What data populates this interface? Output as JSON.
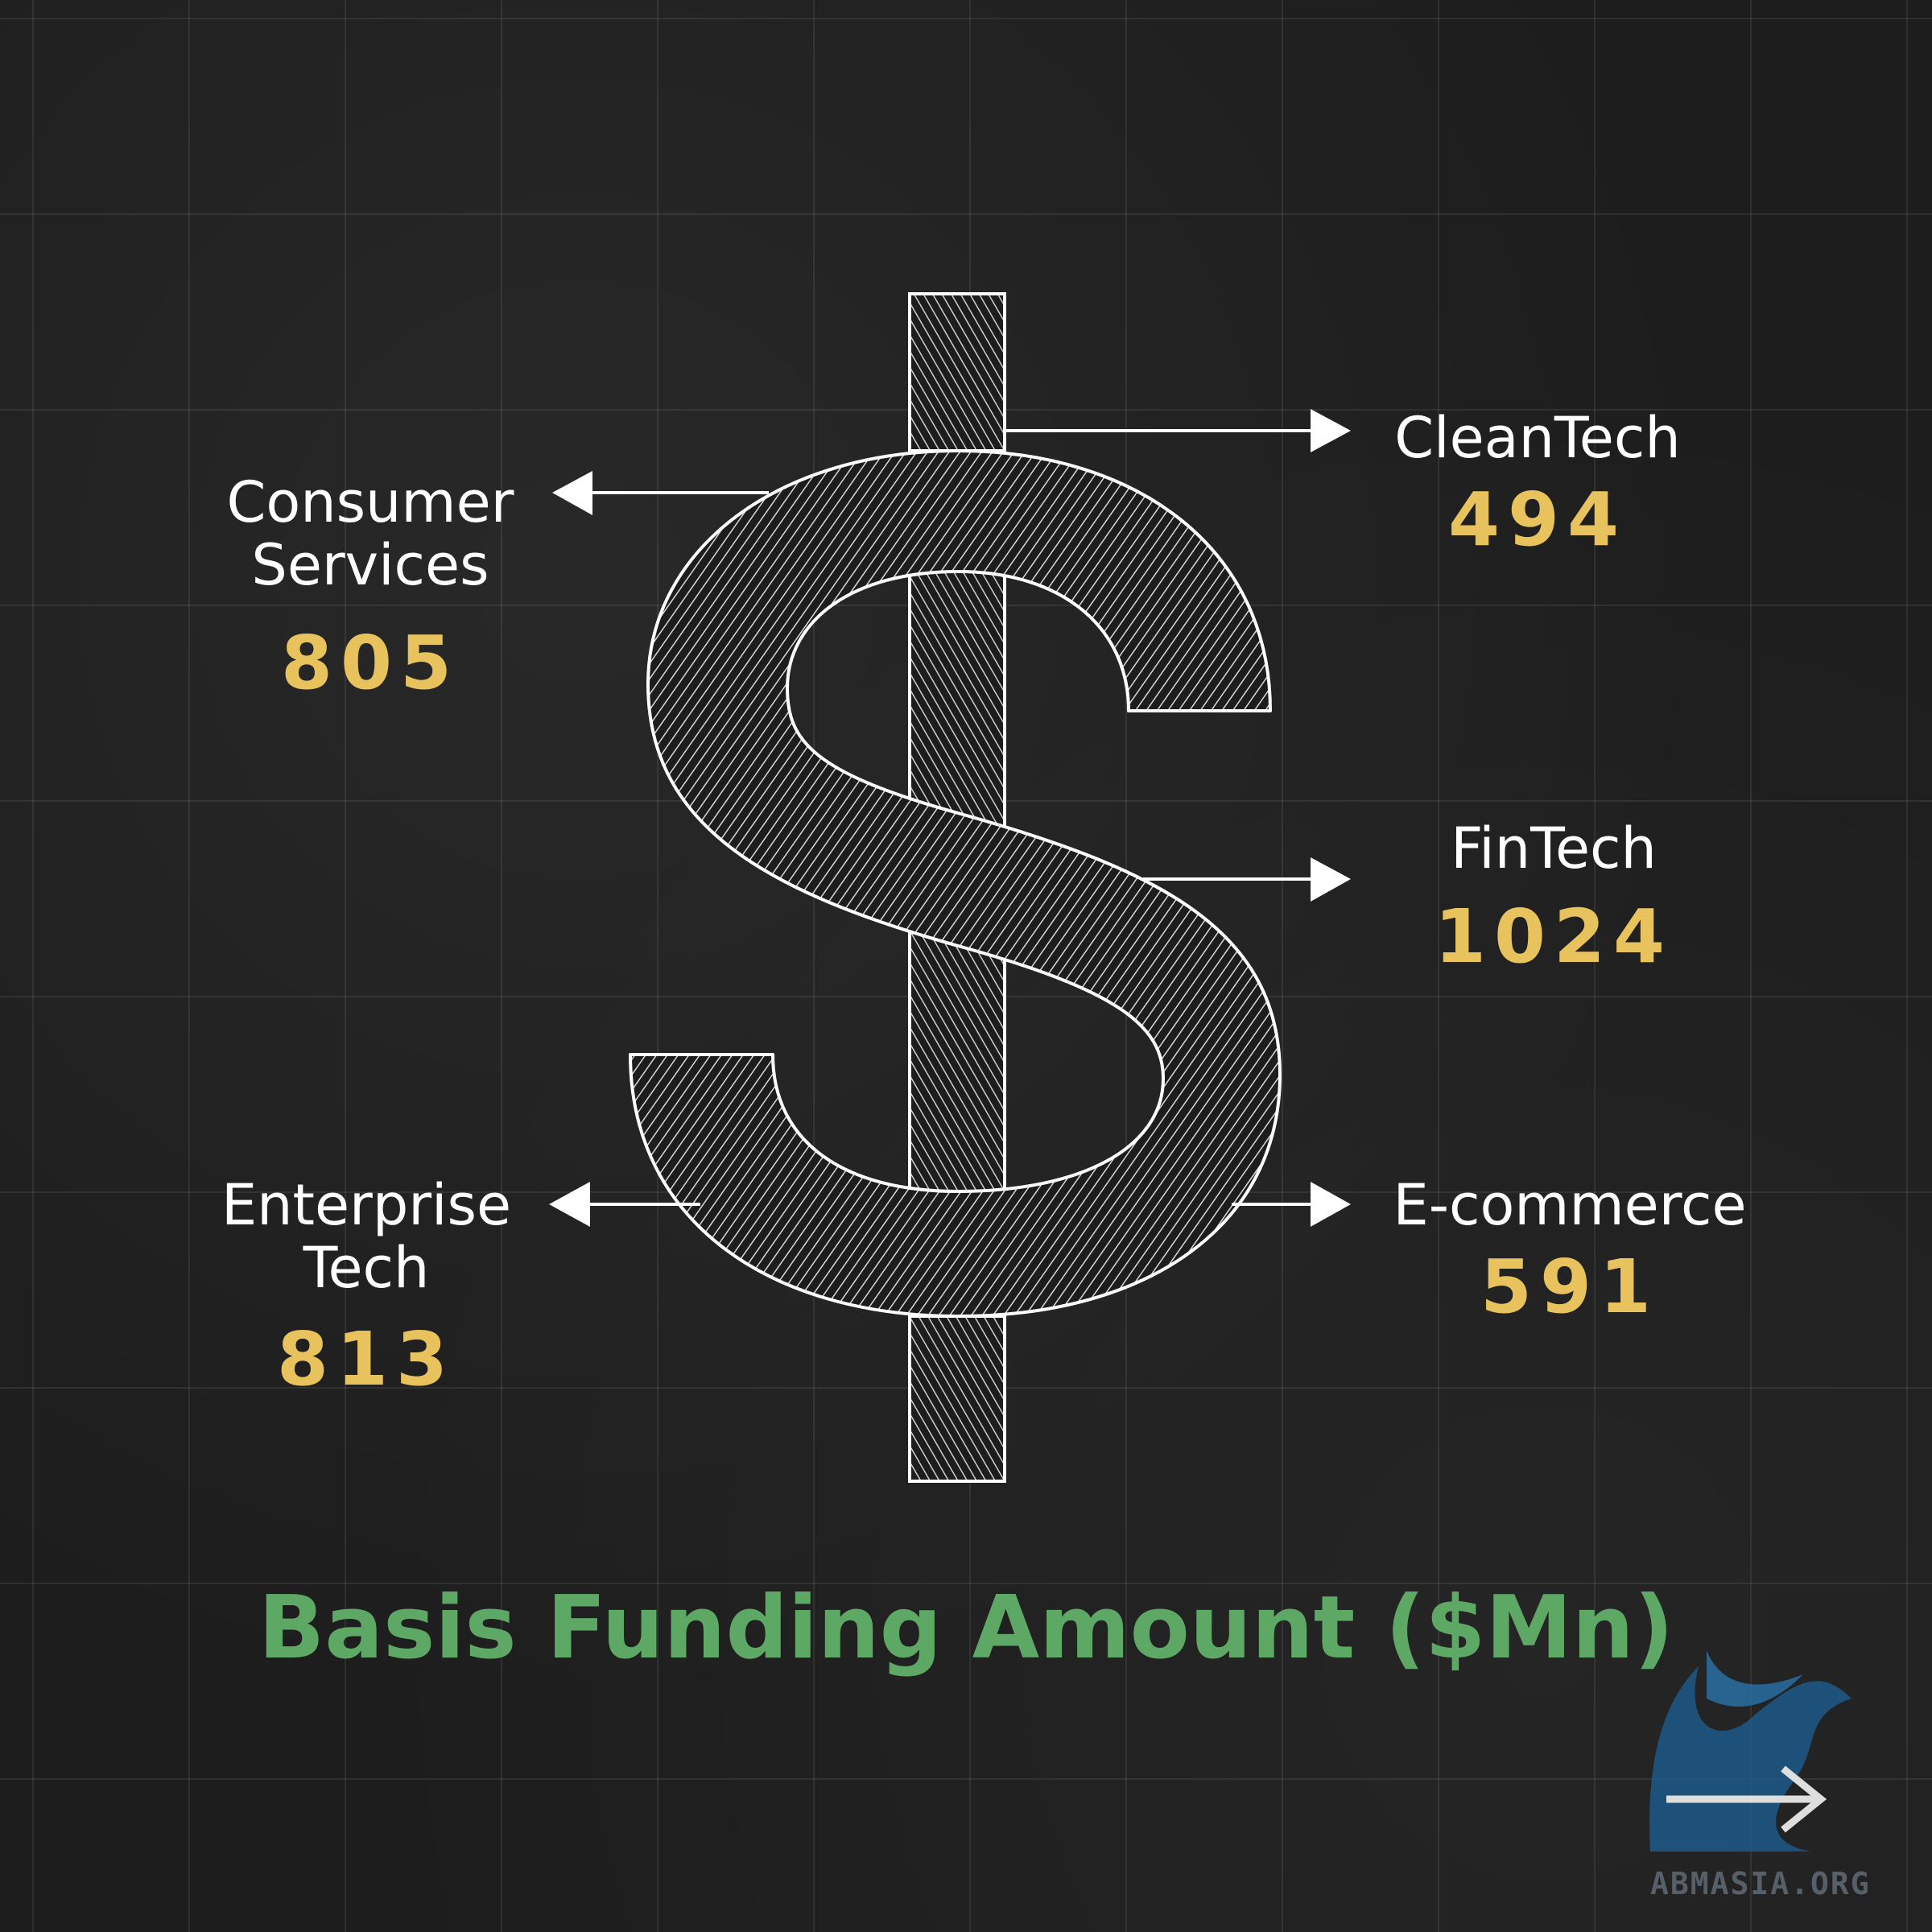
{
  "chart_data": {
    "type": "table",
    "title": "Basis Funding Amount ($Mn)",
    "categories": [
      "CleanTech",
      "Consumer Services",
      "FinTech",
      "Enterprise Tech",
      "E-commerce"
    ],
    "values": [
      494,
      805,
      1024,
      813,
      591
    ],
    "labels": {
      "cleantech": "CleanTech",
      "consumer_1": "Consumer",
      "consumer_2": "Services",
      "fintech": "FinTech",
      "enterprise_1": "Enterprise",
      "enterprise_2": "Tech",
      "ecommerce": "E-commerce"
    },
    "value_text": {
      "cleantech": "494",
      "consumer": "805",
      "fintech": "1024",
      "enterprise": "813",
      "ecommerce": "591"
    }
  },
  "logo": {
    "text": "ABMASIA.ORG",
    "icon": "griffin-logo-icon"
  },
  "colors": {
    "background": "#1d1d1d",
    "value": "#e8c25c",
    "title": "#5ea866",
    "label": "#ffffff"
  }
}
